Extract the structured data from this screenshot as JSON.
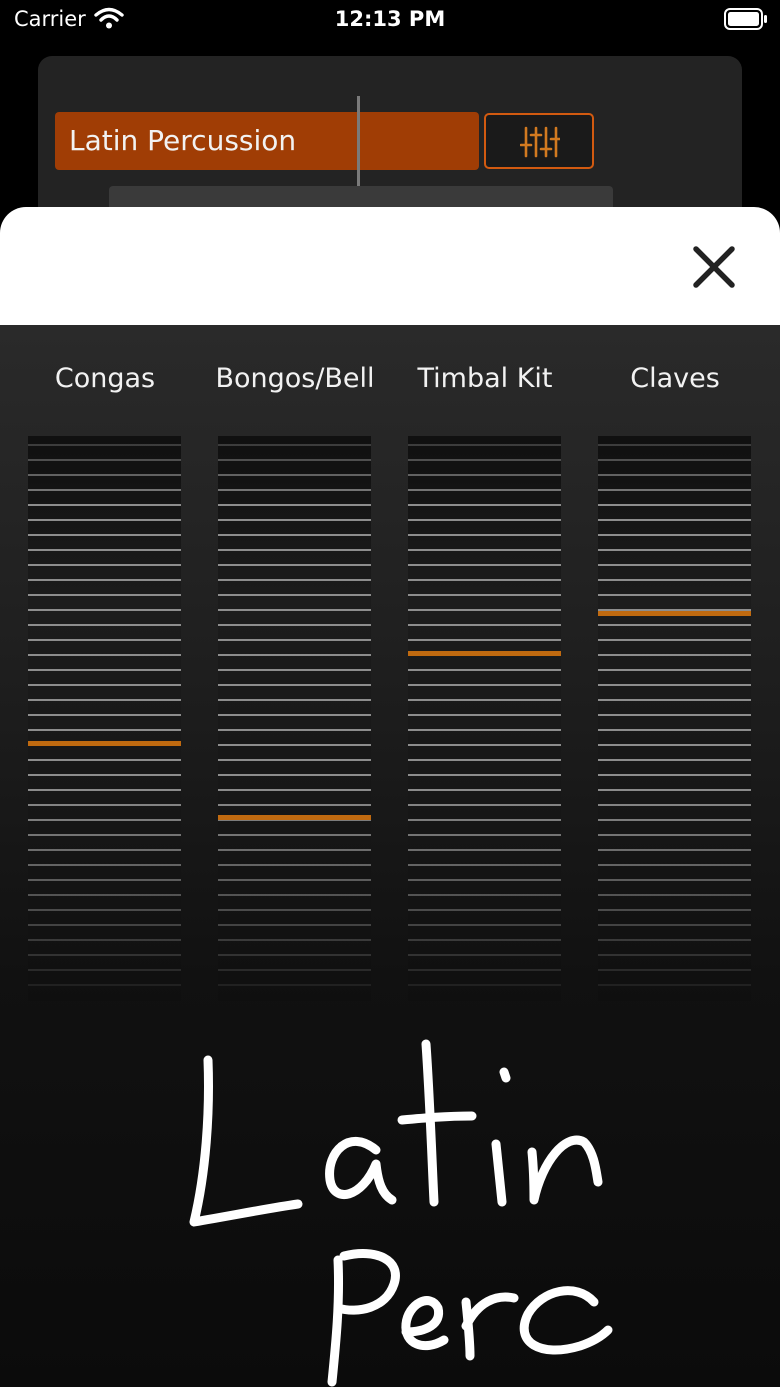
{
  "status_bar": {
    "carrier": "Carrier",
    "time": "12:13 PM"
  },
  "background_app": {
    "preset_label": "Latin Percussion"
  },
  "mixer": {
    "channels": [
      {
        "label": "Congas",
        "level": 0.54
      },
      {
        "label": "Bongos/Bell",
        "level": 0.67
      },
      {
        "label": "Timbal Kit",
        "level": 0.38
      },
      {
        "label": "Claves",
        "level": 0.31
      }
    ]
  },
  "handwritten_name": "Latin Perc",
  "colors": {
    "accent": "#a03d05",
    "fader_level": "#c06a10",
    "sheet_header": "#ffffff"
  }
}
